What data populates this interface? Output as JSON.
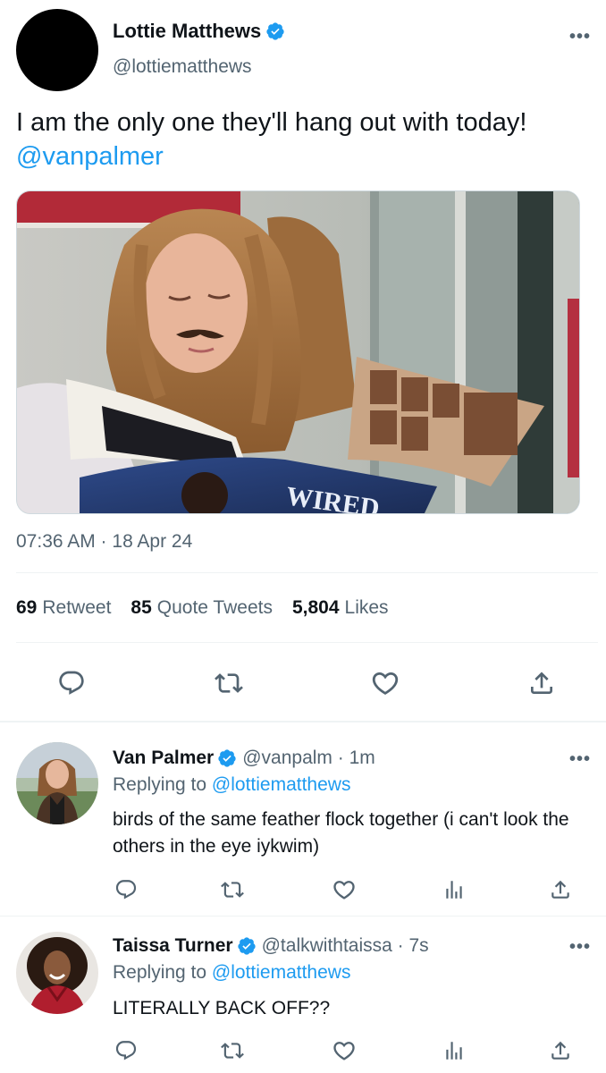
{
  "main_tweet": {
    "display_name": "Lottie Matthews",
    "handle": "@lottiematthews",
    "text": "I am the only one they'll hang out with today!",
    "mention": "@vanpalmer",
    "timestamp": "07:36 AM · 18 Apr 24",
    "stats": {
      "retweets_count": "69",
      "retweets_label": "Retweet",
      "quotes_count": "85",
      "quotes_label": "Quote Tweets",
      "likes_count": "5,804",
      "likes_label": "Likes"
    },
    "media_magazine_text": "WIRED"
  },
  "replies": [
    {
      "display_name": "Van Palmer",
      "handle_time": "@vanpalm · 1m",
      "replying_label": "Replying to",
      "replying_to": "@lottiematthews",
      "text": "birds of the same feather flock together (i can't look the others in the eye iykwim)"
    },
    {
      "display_name": "Taissa Turner",
      "handle_time": "@talkwithtaissa · 7s",
      "replying_label": "Replying to",
      "replying_to": "@lottiematthews",
      "text": "LITERALLY BACK OFF??"
    }
  ],
  "icons": {
    "reply": "reply-icon",
    "retweet": "retweet-icon",
    "like": "heart-icon",
    "share": "share-icon",
    "analytics": "analytics-icon",
    "more": "more-icon",
    "verified": "verified-badge-icon"
  },
  "colors": {
    "accent": "#1d9bf0",
    "text_primary": "#0f1419",
    "text_secondary": "#536471",
    "divider": "#eff3f4"
  }
}
